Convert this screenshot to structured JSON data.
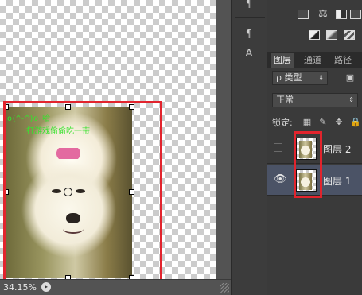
{
  "canvas": {
    "zoom_label": "34.15%",
    "overlay_text_line1": "o(^-^)o 哈",
    "overlay_text_line2": "打游戏偷偷吃一带"
  },
  "tools": {
    "icons": [
      "paragraph-icon",
      "paragraph-styles-icon",
      "character-styles-icon"
    ]
  },
  "adjustments": {
    "icons": [
      "levels-icon",
      "balance-icon",
      "black-white-icon",
      "channel-mixer-icon",
      "gradient-map-icon",
      "selective-color-icon"
    ]
  },
  "layers_panel": {
    "tabs": [
      {
        "label": "图层",
        "active": true
      },
      {
        "label": "通道",
        "active": false
      },
      {
        "label": "路径",
        "active": false
      }
    ],
    "filter_label": "ρ 类型",
    "blend_mode": "正常",
    "lock_label": "锁定:",
    "layers": [
      {
        "name": "图层 2",
        "visible": false,
        "selected": false
      },
      {
        "name": "图层 1",
        "visible": true,
        "selected": true
      }
    ]
  },
  "colors": {
    "highlight_red": "#e2242d",
    "overlay_text": "#36e22d",
    "selected_layer": "#4b5366"
  }
}
